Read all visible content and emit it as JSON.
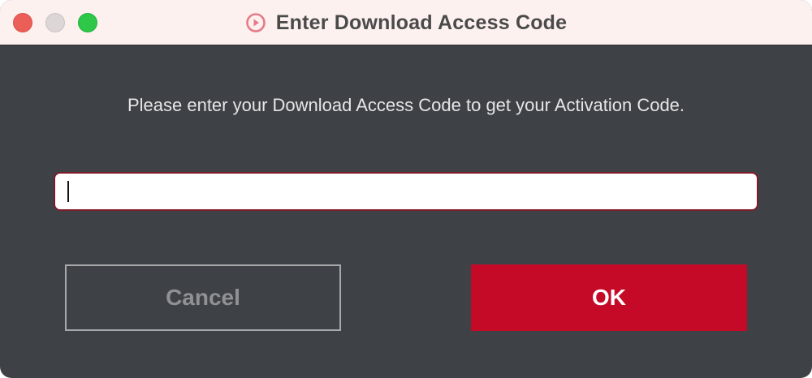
{
  "window": {
    "title": "Enter Download Access Code",
    "title_icon": "play-circle-icon"
  },
  "dialog": {
    "prompt": "Please enter your Download Access Code to get your Activation Code.",
    "input": {
      "value": "",
      "placeholder": ""
    },
    "cancel_label": "Cancel",
    "ok_label": "OK"
  },
  "colors": {
    "accent": "#c50a27",
    "background": "#3e4246",
    "titlebar": "#fcf1ef"
  }
}
